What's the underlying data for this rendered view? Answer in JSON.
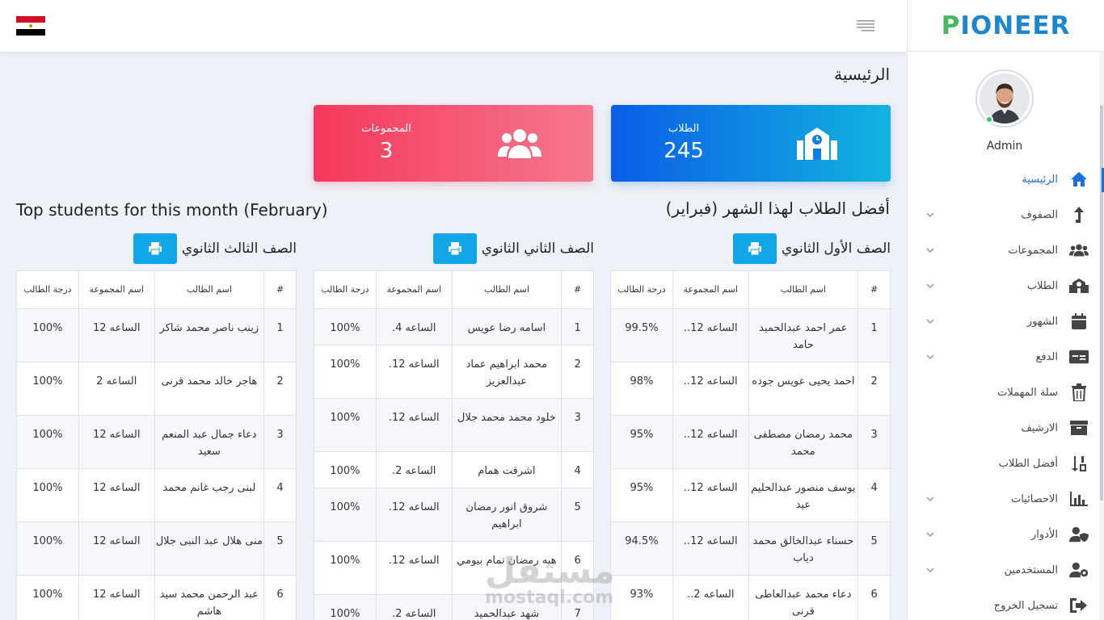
{
  "brand": {
    "first_letter": "P",
    "rest": "IONEER"
  },
  "user": {
    "name": "Admin"
  },
  "menu": [
    {
      "label": "الرئيسية",
      "icon": "home-icon",
      "active": true,
      "chevron": false
    },
    {
      "label": "الصفوف",
      "icon": "level-up-icon",
      "chevron": true
    },
    {
      "label": "المجموعات",
      "icon": "users-icon",
      "chevron": true
    },
    {
      "label": "الطلاب",
      "icon": "school-icon",
      "chevron": true
    },
    {
      "label": "الشهور",
      "icon": "calendar-icon",
      "chevron": true
    },
    {
      "label": "الدفع",
      "icon": "money-icon",
      "chevron": true
    },
    {
      "label": "سلة المهملات",
      "icon": "trash-icon",
      "chevron": false
    },
    {
      "label": "الارشيف",
      "icon": "archive-icon",
      "chevron": false
    },
    {
      "label": "أفضل الطلاب",
      "icon": "sort-numeric-icon",
      "chevron": false
    },
    {
      "label": "الاحصائيات",
      "icon": "bar-chart-icon",
      "chevron": true
    },
    {
      "label": "الأدوار",
      "icon": "user-shield-icon",
      "chevron": true
    },
    {
      "label": "المستخدمين",
      "icon": "user-cog-icon",
      "chevron": true
    },
    {
      "label": "تسجيل الخروج",
      "icon": "sign-out-icon",
      "chevron": false
    }
  ],
  "page_title": "الرئيسية",
  "stats": {
    "students": {
      "label": "الطلاب",
      "value": "245"
    },
    "groups": {
      "label": "المجموعات",
      "value": "3"
    }
  },
  "top_title_ar": "أفضل الطلاب لهذا الشهر (فبراير)",
  "top_title_en": "Top students for this month (February)",
  "table_headers": {
    "num": "#",
    "name": "اسم الطالب",
    "group": "اسم المجموعة",
    "grade": "درجة الطالب"
  },
  "columns": [
    {
      "title": "الصف الأول الثانوي",
      "rows": [
        {
          "num": "1",
          "name": "عمر احمد عبدالحميد حامد",
          "group": "الساعه 12..",
          "grade": "99.5%"
        },
        {
          "num": "2",
          "name": "احمد يحيى عويس جوده",
          "group": "الساعه 12..",
          "grade": "98%"
        },
        {
          "num": "3",
          "name": "محمد رمضان مصطفى محمد",
          "group": "الساعه 12..",
          "grade": "95%"
        },
        {
          "num": "4",
          "name": "يوسف منصور عبدالحليم عيد",
          "group": "الساعه 12..",
          "grade": "95%"
        },
        {
          "num": "5",
          "name": "حسناء عبدالخالق محمد دياب",
          "group": "الساعه 12..",
          "grade": "94.5%"
        },
        {
          "num": "6",
          "name": "دعاء محمد عبدالعاطى قرنى",
          "group": "الساعه 2..",
          "grade": "93%"
        }
      ]
    },
    {
      "title": "الصف الثاني الثانوي",
      "rows": [
        {
          "num": "1",
          "name": "اسامه رضا عويس",
          "group": "الساعه 4.",
          "grade": "100%"
        },
        {
          "num": "2",
          "name": "محمد ابراهيم عماد عبدالعزيز",
          "group": "الساعه 12.",
          "grade": "100%"
        },
        {
          "num": "3",
          "name": "خلود محمد محمد جلال",
          "group": "الساعه 12.",
          "grade": "100%"
        },
        {
          "num": "4",
          "name": "اشرقت همام",
          "group": "الساعه 2.",
          "grade": "100%"
        },
        {
          "num": "5",
          "name": "شروق انور رمضان ابراهيم",
          "group": "الساعه 12.",
          "grade": "100%"
        },
        {
          "num": "6",
          "name": "هبه رمضان تمام بيومي",
          "group": "الساعه 12.",
          "grade": "100%"
        },
        {
          "num": "7",
          "name": "شهد عبدالحميد",
          "group": "الساعه 2.",
          "grade": "100%"
        }
      ]
    },
    {
      "title": "الصف الثالث الثانوي",
      "rows": [
        {
          "num": "1",
          "name": "زينب ناصر محمد شاكر",
          "group": "الساعه 12",
          "grade": "100%"
        },
        {
          "num": "2",
          "name": "هاجر خالد محمد قرنى",
          "group": "الساعه 2",
          "grade": "100%"
        },
        {
          "num": "3",
          "name": "دعاء جمال عبد المنعم سعيد",
          "group": "الساعه 12",
          "grade": "100%"
        },
        {
          "num": "4",
          "name": "لبنى رجب غانم محمد",
          "group": "الساعه 12",
          "grade": "100%"
        },
        {
          "num": "5",
          "name": "منى هلال عبد النبى جلال",
          "group": "الساعه 12",
          "grade": "100%"
        },
        {
          "num": "6",
          "name": "عبد الرحمن محمد سيد هاشم",
          "group": "الساعه 12",
          "grade": "100%"
        }
      ]
    }
  ],
  "watermark": {
    "ar": "مستقل",
    "en": "mostaql.com"
  }
}
